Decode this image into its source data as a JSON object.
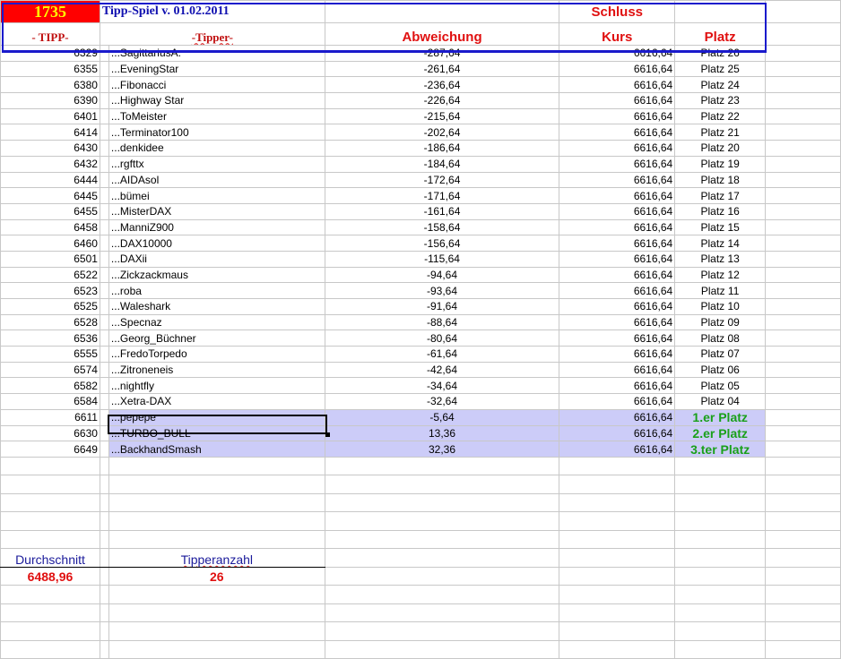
{
  "header": {
    "tipp_count": "1735",
    "title": "Tipp-Spiel v. 01.02.2011",
    "schluss": "Schluss",
    "col_tipp": "- TIPP-",
    "col_tipper": "-Tipper-",
    "col_abweichung": "Abweichung",
    "col_kurs": "Kurs",
    "col_platz": "Platz"
  },
  "rows": [
    {
      "tipp": "6329",
      "tipper": "...SagittariusA.",
      "abw": "-287,64",
      "kurs": "6616,64",
      "platz": "Platz 26"
    },
    {
      "tipp": "6355",
      "tipper": "...EveningStar",
      "abw": "-261,64",
      "kurs": "6616,64",
      "platz": "Platz 25"
    },
    {
      "tipp": "6380",
      "tipper": "...Fibonacci",
      "abw": "-236,64",
      "kurs": "6616,64",
      "platz": "Platz 24"
    },
    {
      "tipp": "6390",
      "tipper": "...Highway Star",
      "abw": "-226,64",
      "kurs": "6616,64",
      "platz": "Platz 23"
    },
    {
      "tipp": "6401",
      "tipper": "...ToMeister",
      "abw": "-215,64",
      "kurs": "6616,64",
      "platz": "Platz 22"
    },
    {
      "tipp": "6414",
      "tipper": "...Terminator100",
      "abw": "-202,64",
      "kurs": "6616,64",
      "platz": "Platz 21"
    },
    {
      "tipp": "6430",
      "tipper": "...denkidee",
      "abw": "-186,64",
      "kurs": "6616,64",
      "platz": "Platz 20"
    },
    {
      "tipp": "6432",
      "tipper": "...rgfttx",
      "abw": "-184,64",
      "kurs": "6616,64",
      "platz": "Platz 19"
    },
    {
      "tipp": "6444",
      "tipper": "...AIDAsol",
      "abw": "-172,64",
      "kurs": "6616,64",
      "platz": "Platz 18"
    },
    {
      "tipp": "6445",
      "tipper": "...bümei",
      "abw": "-171,64",
      "kurs": "6616,64",
      "platz": "Platz 17"
    },
    {
      "tipp": "6455",
      "tipper": "...MisterDAX",
      "abw": "-161,64",
      "kurs": "6616,64",
      "platz": "Platz 16"
    },
    {
      "tipp": "6458",
      "tipper": "...ManniZ900",
      "abw": "-158,64",
      "kurs": "6616,64",
      "platz": "Platz 15"
    },
    {
      "tipp": "6460",
      "tipper": "...DAX10000",
      "abw": "-156,64",
      "kurs": "6616,64",
      "platz": "Platz 14"
    },
    {
      "tipp": "6501",
      "tipper": "...DAXii",
      "abw": "-115,64",
      "kurs": "6616,64",
      "platz": "Platz 13"
    },
    {
      "tipp": "6522",
      "tipper": "...Zickzackmaus",
      "abw": "-94,64",
      "kurs": "6616,64",
      "platz": "Platz 12"
    },
    {
      "tipp": "6523",
      "tipper": "...roba",
      "abw": "-93,64",
      "kurs": "6616,64",
      "platz": "Platz 11"
    },
    {
      "tipp": "6525",
      "tipper": "...Waleshark",
      "abw": "-91,64",
      "kurs": "6616,64",
      "platz": "Platz 10"
    },
    {
      "tipp": "6528",
      "tipper": "...Specnaz",
      "abw": "-88,64",
      "kurs": "6616,64",
      "platz": "Platz 09"
    },
    {
      "tipp": "6536",
      "tipper": "...Georg_Büchner",
      "abw": "-80,64",
      "kurs": "6616,64",
      "platz": "Platz 08"
    },
    {
      "tipp": "6555",
      "tipper": "...FredoTorpedo",
      "abw": "-61,64",
      "kurs": "6616,64",
      "platz": "Platz 07"
    },
    {
      "tipp": "6574",
      "tipper": "...Zitroneneis",
      "abw": "-42,64",
      "kurs": "6616,64",
      "platz": "Platz 06"
    },
    {
      "tipp": "6582",
      "tipper": "...nightfly",
      "abw": "-34,64",
      "kurs": "6616,64",
      "platz": "Platz 05"
    },
    {
      "tipp": "6584",
      "tipper": "...Xetra-DAX",
      "abw": "-32,64",
      "kurs": "6616,64",
      "platz": "Platz 04"
    },
    {
      "tipp": "6611",
      "tipper": "...pepepe",
      "abw": "-5,64",
      "kurs": "6616,64",
      "platz": "1.er Platz",
      "winner": true
    },
    {
      "tipp": "6630",
      "tipper": "...TURBO_BULL",
      "abw": "13,36",
      "kurs": "6616,64",
      "platz": "2.er Platz",
      "winner": true
    },
    {
      "tipp": "6649",
      "tipper": "...BackhandSmash",
      "abw": "32,36",
      "kurs": "6616,64",
      "platz": "3.ter Platz",
      "winner": true
    }
  ],
  "summary": {
    "durchschnitt_label": "Durchschnitt",
    "durchschnitt_value": "6488,96",
    "tipperanzahl_label": "Tipperanzahl",
    "tipperanzahl_value": "26"
  },
  "colors": {
    "highlight": "#ccccf8",
    "winner_text": "#1aa01a",
    "header_red": "#e01010",
    "frame_blue": "#1a1acc"
  }
}
